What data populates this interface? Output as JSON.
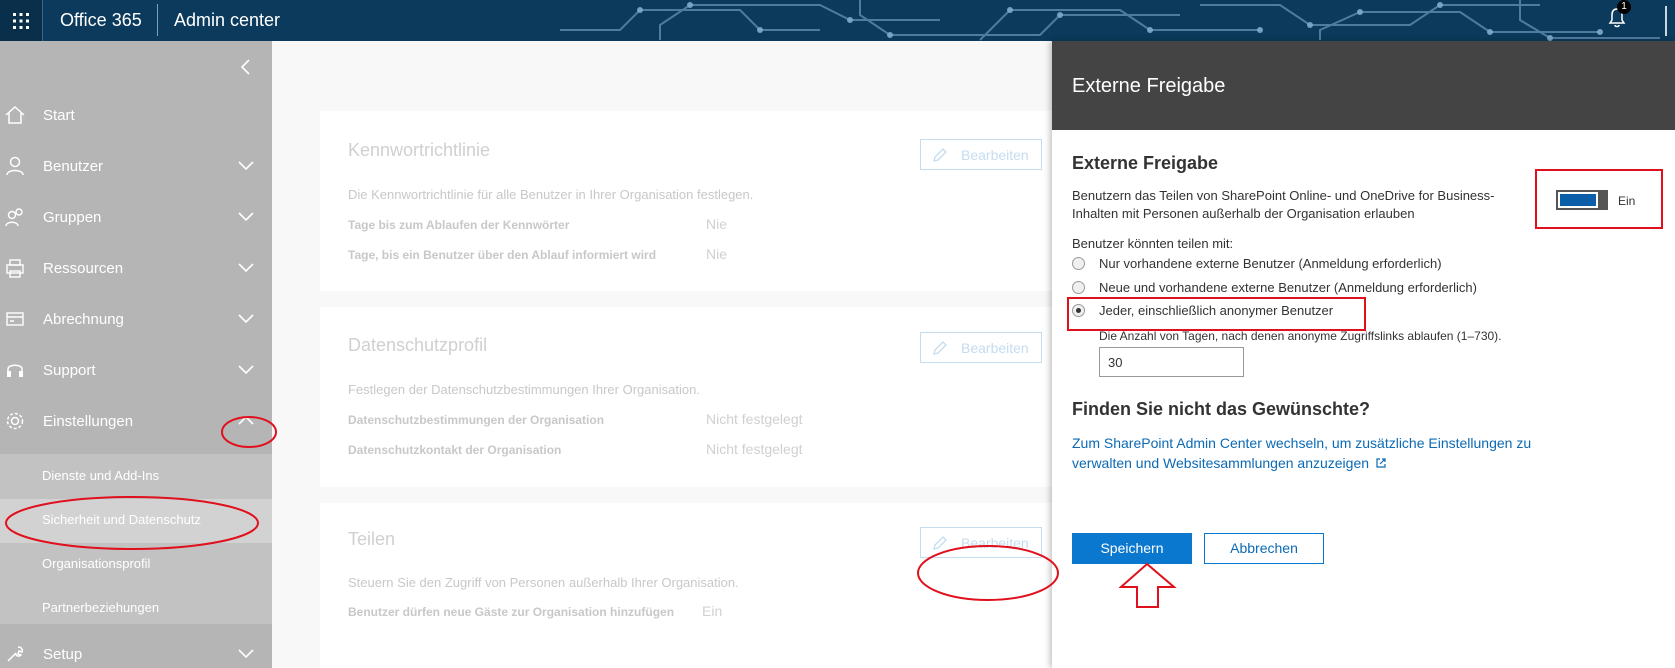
{
  "header": {
    "brand": "Office 365",
    "app_title": "Admin center",
    "notification_count": "1",
    "icons": [
      "waffle-icon",
      "bell-icon"
    ]
  },
  "sidebar": {
    "items": [
      {
        "label": "Start",
        "icon": "home-icon"
      },
      {
        "label": "Benutzer",
        "icon": "person-icon"
      },
      {
        "label": "Gruppen",
        "icon": "group-icon"
      },
      {
        "label": "Ressourcen",
        "icon": "printer-icon"
      },
      {
        "label": "Abrechnung",
        "icon": "billing-icon"
      },
      {
        "label": "Support",
        "icon": "headset-icon"
      },
      {
        "label": "Einstellungen",
        "icon": "gear-icon"
      },
      {
        "label": "Setup",
        "icon": "wrench-icon"
      }
    ],
    "sub_items": [
      {
        "label": "Dienste und Add-Ins"
      },
      {
        "label": "Sicherheit und Datenschutz"
      },
      {
        "label": "Organisationsprofil"
      },
      {
        "label": "Partnerbeziehungen"
      }
    ]
  },
  "main": {
    "cards": [
      {
        "title": "Kennwortrichtlinie",
        "description": "Die Kennwortrichtlinie für alle Benutzer in Ihrer Organisation festlegen.",
        "edit_label": "Bearbeiten",
        "rows": [
          {
            "label": "Tage bis zum Ablaufen der Kennwörter",
            "value": "Nie"
          },
          {
            "label": "Tage, bis ein Benutzer über den Ablauf informiert wird",
            "value": "Nie"
          }
        ]
      },
      {
        "title": "Datenschutzprofil",
        "description": "Festlegen der Datenschutzbestimmungen Ihrer Organisation.",
        "edit_label": "Bearbeiten",
        "rows": [
          {
            "label": "Datenschutzbestimmungen der Organisation",
            "value": "Nicht festgelegt"
          },
          {
            "label": "Datenschutzkontakt der Organisation",
            "value": "Nicht festgelegt"
          }
        ]
      },
      {
        "title": "Teilen",
        "description": "Steuern Sie den Zugriff von Personen außerhalb Ihrer Organisation.",
        "edit_label": "Bearbeiten",
        "rows": [
          {
            "label": "Benutzer dürfen neue Gäste zur Organisation hinzufügen",
            "value": "Ein"
          }
        ]
      }
    ]
  },
  "panel": {
    "title": "Externe Freigabe",
    "section_title": "Externe Freigabe",
    "description": "Benutzern das Teilen von SharePoint Online- und OneDrive for Business-Inhalten mit Personen außerhalb der Organisation erlauben",
    "toggle_label": "Ein",
    "toggle_on": true,
    "share_with_label": "Benutzer könnten teilen mit:",
    "options": [
      {
        "label": "Nur vorhandene externe Benutzer (Anmeldung erforderlich)",
        "selected": false
      },
      {
        "label": "Neue und vorhandene externe Benutzer (Anmeldung erforderlich)",
        "selected": false
      },
      {
        "label": "Jeder, einschließlich anonymer Benutzer",
        "selected": true
      }
    ],
    "days_label": "Die Anzahl von Tagen, nach denen anonyme Zugriffslinks ablaufen (1–730).",
    "days_value": "30",
    "help_title": "Finden Sie nicht das Gewünschte?",
    "help_link": "Zum SharePoint Admin Center wechseln, um zusätzliche Einstellungen zu verwalten und Websitesammlungen anzuzeigen",
    "save_label": "Speichern",
    "cancel_label": "Abbrechen"
  },
  "colors": {
    "accent": "#0b78d0",
    "annotation": "#e0101c",
    "sidebar": "#b5b5b5",
    "header": "#0b3a5c"
  }
}
